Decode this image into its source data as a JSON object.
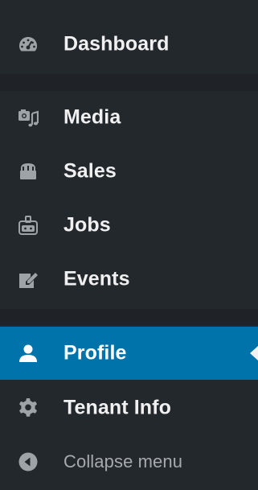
{
  "sidebar": {
    "items": [
      {
        "id": "dashboard",
        "label": "Dashboard",
        "icon": "dashboard-icon"
      },
      {
        "id": "media",
        "label": "Media",
        "icon": "media-icon"
      },
      {
        "id": "sales",
        "label": "Sales",
        "icon": "shopping-bag-icon"
      },
      {
        "id": "jobs",
        "label": "Jobs",
        "icon": "jobs-icon"
      },
      {
        "id": "events",
        "label": "Events",
        "icon": "edit-note-icon"
      },
      {
        "id": "profile",
        "label": "Profile",
        "icon": "user-icon",
        "active": true
      },
      {
        "id": "tenant-info",
        "label": "Tenant Info",
        "icon": "gear-icon"
      }
    ],
    "collapse_label": "Collapse menu",
    "collapse_icon": "collapse-arrow-icon"
  },
  "colors": {
    "background": "#23282d",
    "active_background": "#0073aa",
    "icon": "#9ea3a8",
    "text": "#f0f0f1",
    "collapse_text": "#a7aaad"
  }
}
